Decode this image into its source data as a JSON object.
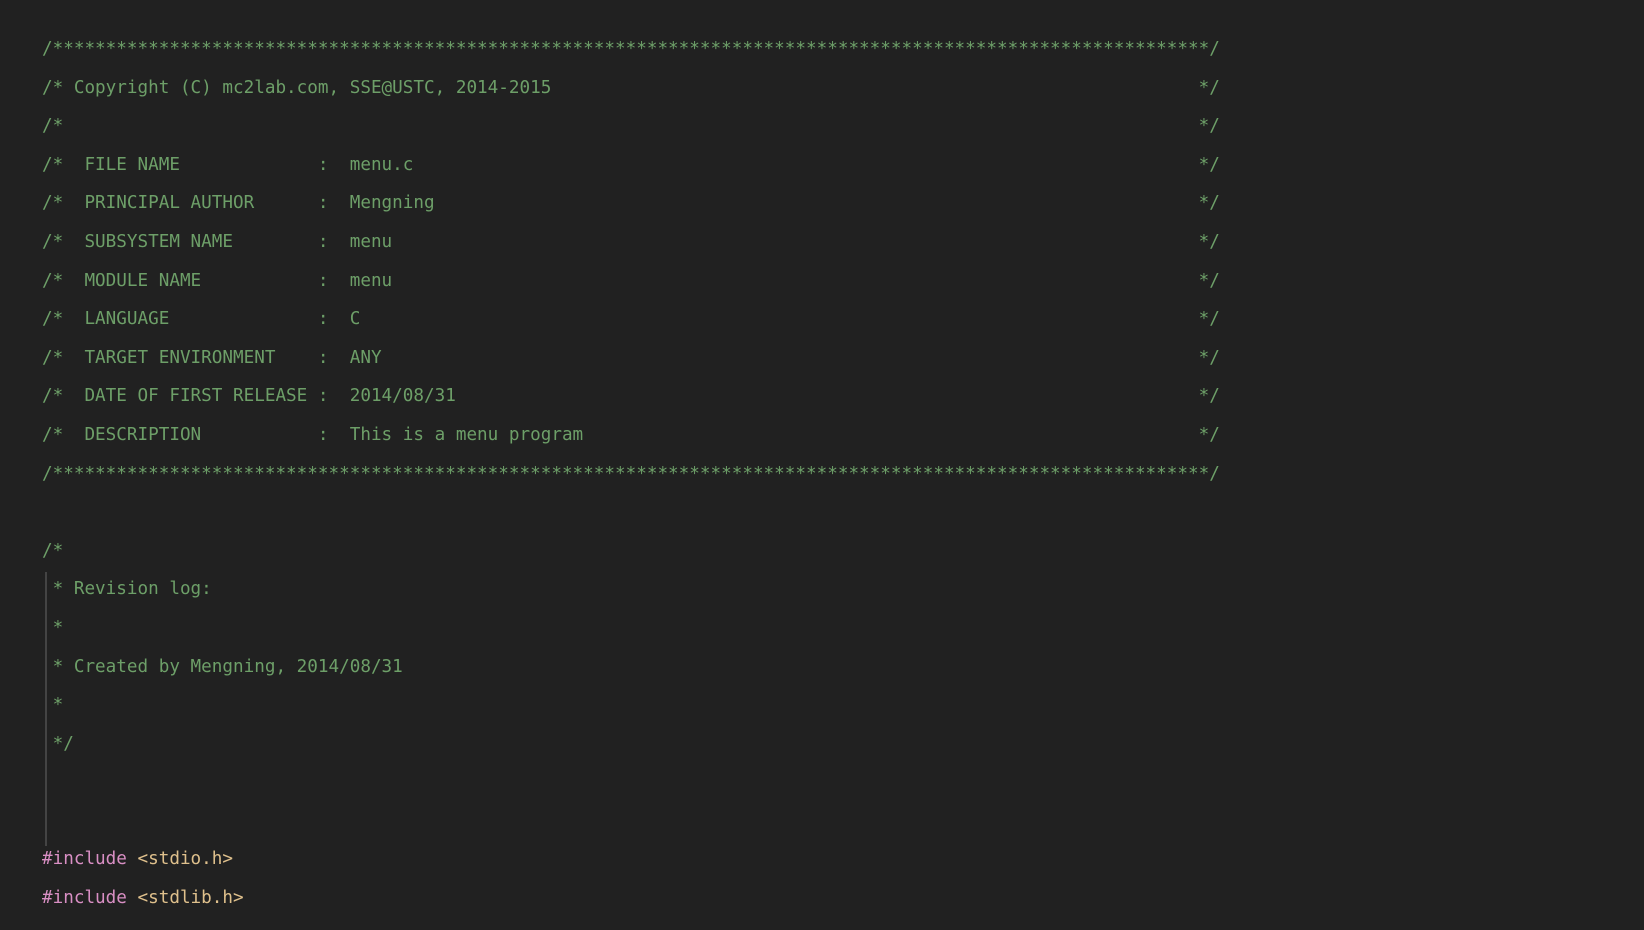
{
  "editor": {
    "theme": "dark",
    "background_color": "#212121",
    "comment_color": "#6d9f68",
    "preprocessor_color": "#d98fc4",
    "include_path_color": "#dfc08c",
    "indent_guide_color": "#4a4a4a",
    "language": "C",
    "file_name": "menu.c"
  },
  "lines": [
    {
      "id": 1,
      "kind": "comment",
      "text": "/*************************************************************************************************************/"
    },
    {
      "id": 2,
      "kind": "comment",
      "text": "/* Copyright (C) mc2lab.com, SSE@USTC, 2014-2015                                                             */"
    },
    {
      "id": 3,
      "kind": "comment",
      "text": "/*                                                                                                           */"
    },
    {
      "id": 4,
      "kind": "comment",
      "text": "/*  FILE NAME             :  menu.c                                                                          */"
    },
    {
      "id": 5,
      "kind": "comment",
      "text": "/*  PRINCIPAL AUTHOR      :  Mengning                                                                        */"
    },
    {
      "id": 6,
      "kind": "comment",
      "text": "/*  SUBSYSTEM NAME        :  menu                                                                            */"
    },
    {
      "id": 7,
      "kind": "comment",
      "text": "/*  MODULE NAME           :  menu                                                                            */"
    },
    {
      "id": 8,
      "kind": "comment",
      "text": "/*  LANGUAGE              :  C                                                                               */"
    },
    {
      "id": 9,
      "kind": "comment",
      "text": "/*  TARGET ENVIRONMENT    :  ANY                                                                             */"
    },
    {
      "id": 10,
      "kind": "comment",
      "text": "/*  DATE OF FIRST RELEASE :  2014/08/31                                                                      */"
    },
    {
      "id": 11,
      "kind": "comment",
      "text": "/*  DESCRIPTION           :  This is a menu program                                                          */"
    },
    {
      "id": 12,
      "kind": "comment",
      "text": "/*************************************************************************************************************/"
    },
    {
      "id": 13,
      "kind": "blank",
      "text": ""
    },
    {
      "id": 14,
      "kind": "comment",
      "text": "/*"
    },
    {
      "id": 15,
      "kind": "comment",
      "text": " * Revision log:"
    },
    {
      "id": 16,
      "kind": "comment",
      "text": " *"
    },
    {
      "id": 17,
      "kind": "comment",
      "text": " * Created by Mengning, 2014/08/31"
    },
    {
      "id": 18,
      "kind": "comment",
      "text": " *"
    },
    {
      "id": 19,
      "kind": "comment",
      "text": " */"
    },
    {
      "id": 20,
      "kind": "blank",
      "text": ""
    },
    {
      "id": 21,
      "kind": "blank",
      "text": ""
    },
    {
      "id": 22,
      "kind": "include",
      "directive": "#include",
      "path": " <stdio.h>"
    },
    {
      "id": 23,
      "kind": "include",
      "directive": "#include",
      "path": " <stdlib.h>"
    }
  ]
}
